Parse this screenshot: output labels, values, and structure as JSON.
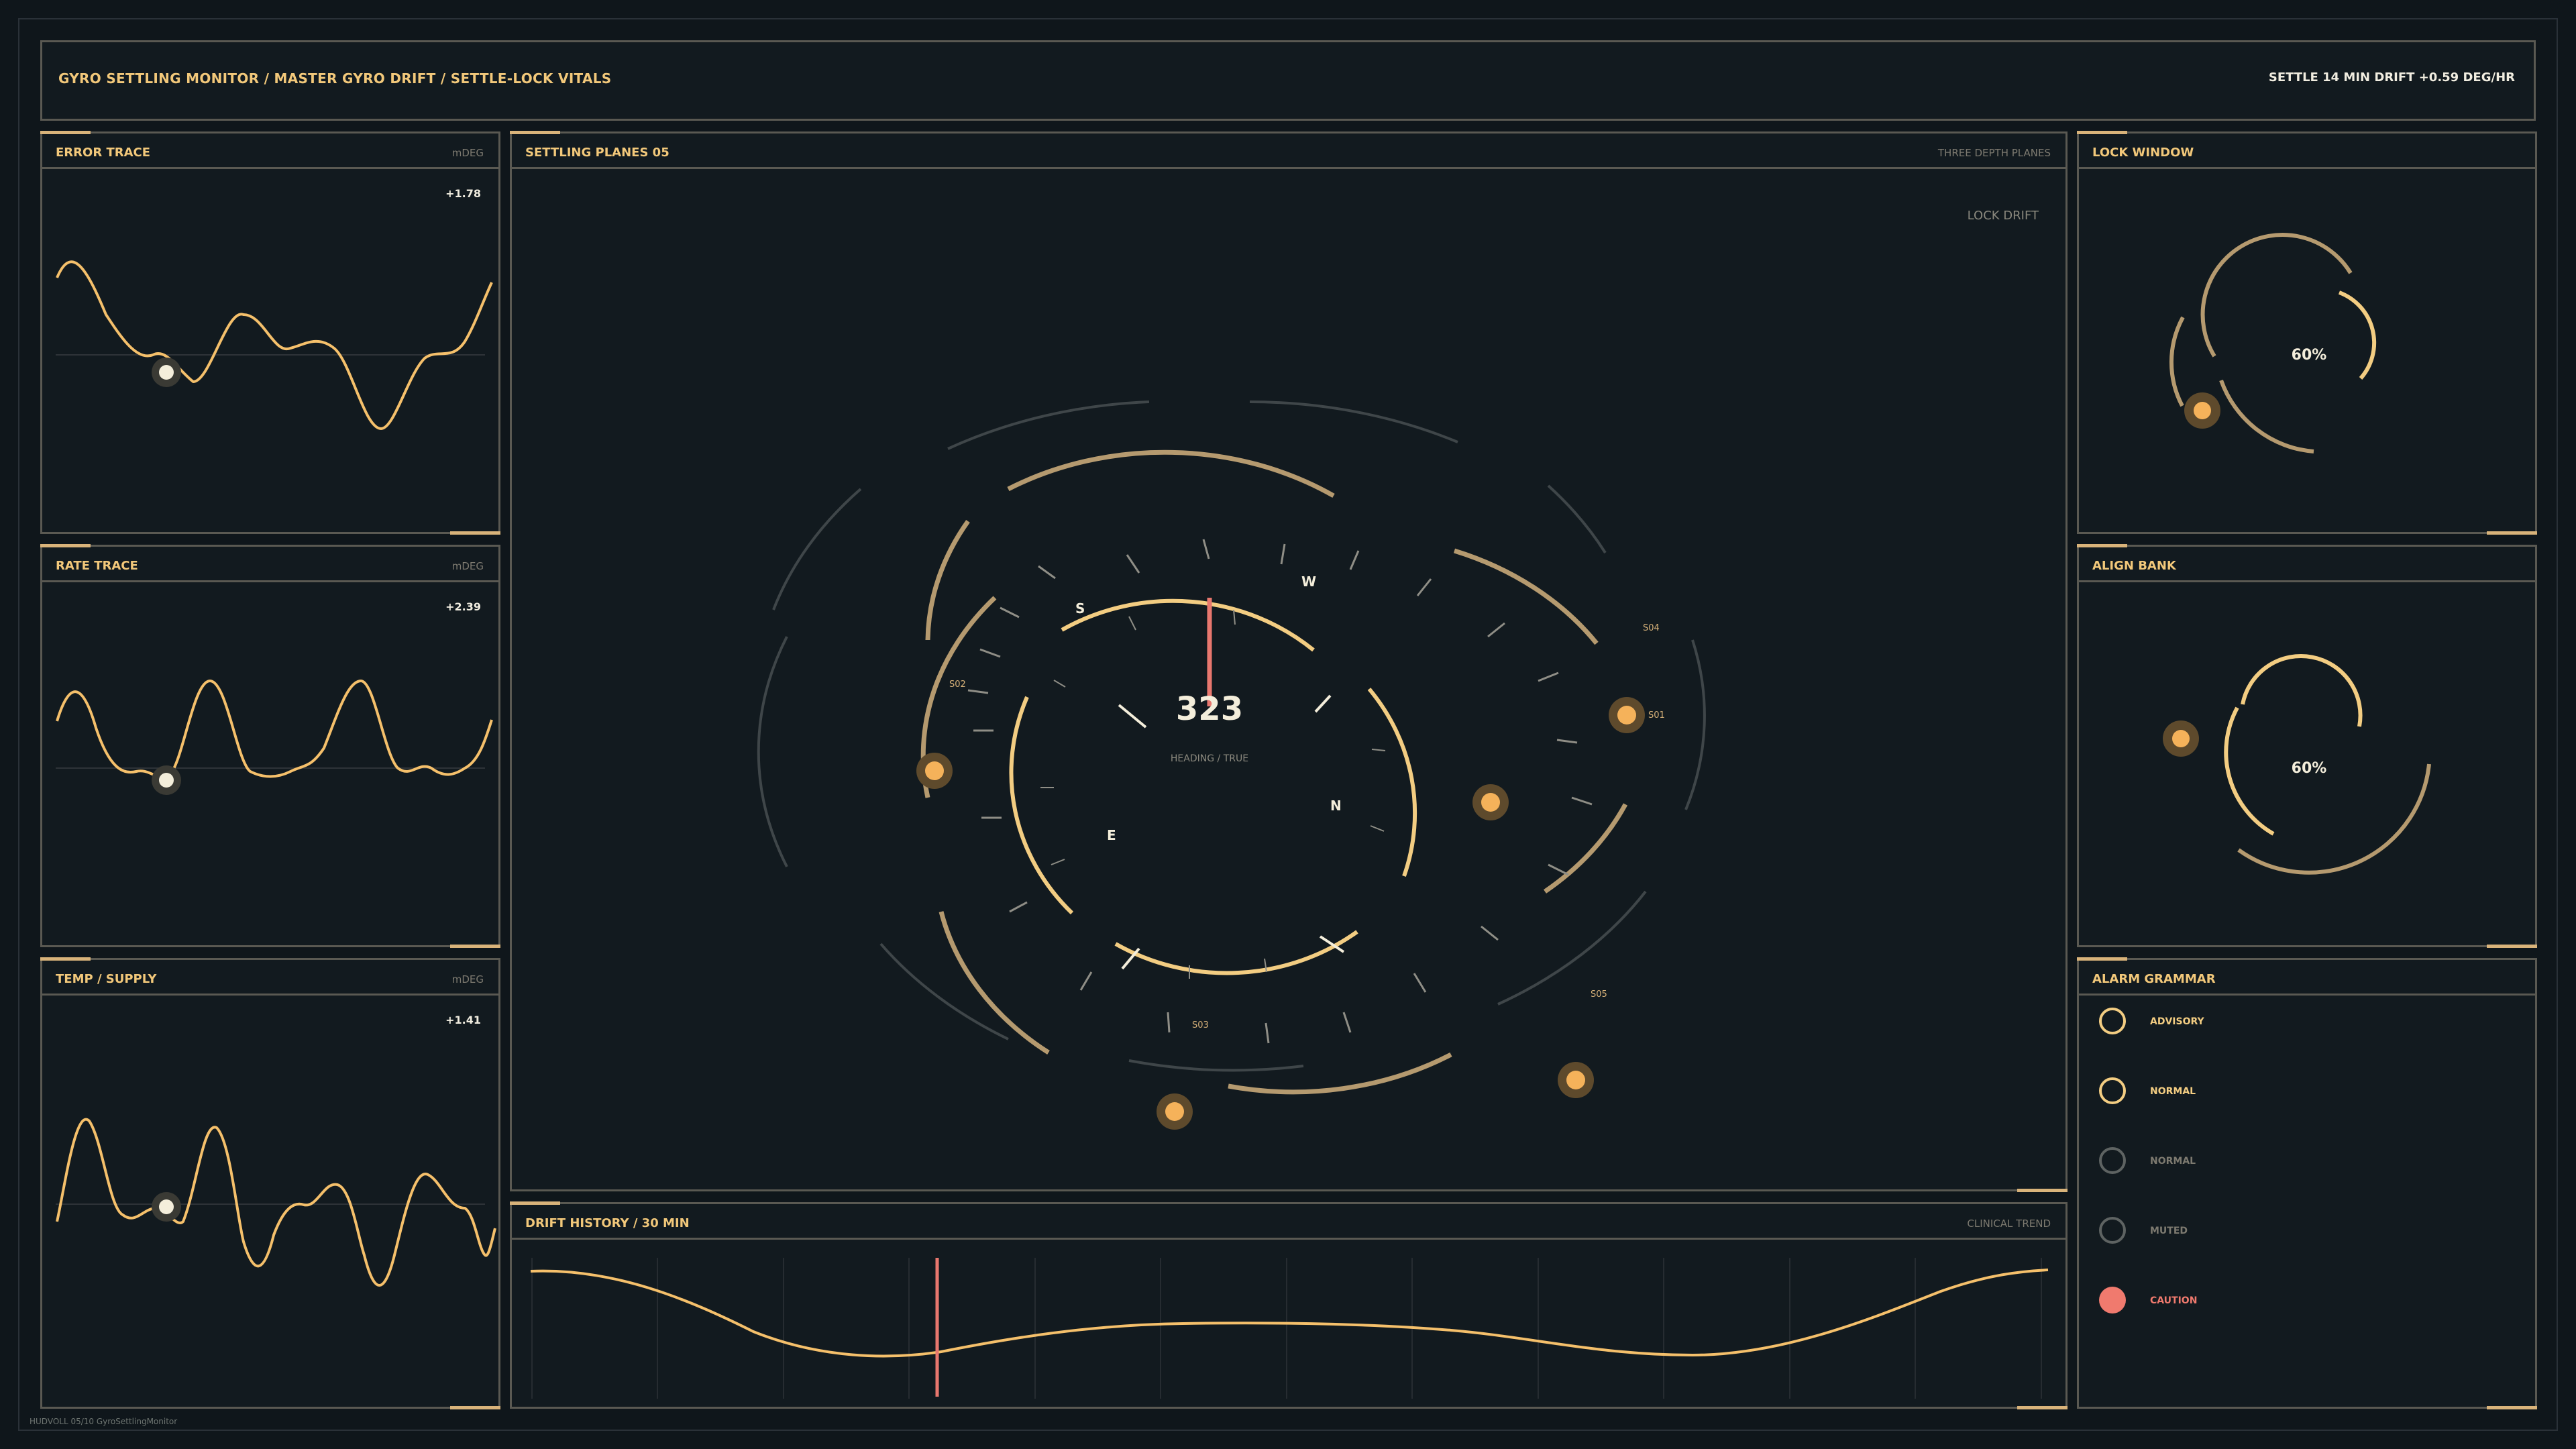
{
  "header": {
    "title": "GYRO SETTLING MONITOR / MASTER GYRO DRIFT / SETTLE-LOCK VITALS",
    "status": "SETTLE 14 MIN   DRIFT +0.59 DEG/HR"
  },
  "left_panels": [
    {
      "title": "ERROR TRACE",
      "unit": "mDEG",
      "readout": "+1.78"
    },
    {
      "title": "RATE TRACE",
      "unit": "mDEG",
      "readout": "+2.39"
    },
    {
      "title": "TEMP / SUPPLY",
      "unit": "mDEG",
      "readout": "+1.41"
    }
  ],
  "center": {
    "title": "SETTLING PLANES 05",
    "subtitle": "THREE DEPTH PLANES",
    "lock_drift": "LOCK DRIFT",
    "heading_value": "323",
    "heading_label": "HEADING / TRUE",
    "cardinals": {
      "s": "S",
      "w": "W",
      "e": "E",
      "n": "N"
    },
    "markers": [
      "S01",
      "S02",
      "S03",
      "S04",
      "S05"
    ]
  },
  "drift_history": {
    "title": "DRIFT HISTORY / 30 MIN",
    "subtitle": "CLINICAL TREND"
  },
  "right_panels": {
    "lock_window": {
      "title": "LOCK WINDOW",
      "value": "60%",
      "level": 0.6
    },
    "align_bank": {
      "title": "ALIGN BANK",
      "value": "60%",
      "level": 0.6
    },
    "alarm_grammar": {
      "title": "ALARM GRAMMAR",
      "items": [
        {
          "label": "ADVISORY",
          "state": "advisory"
        },
        {
          "label": "NORMAL",
          "state": "normal"
        },
        {
          "label": "NORMAL",
          "state": "normal-dim"
        },
        {
          "label": "MUTED",
          "state": "muted"
        },
        {
          "label": "CAUTION",
          "state": "caution"
        }
      ]
    }
  },
  "footer": "HUDVOLL 05/10 GyroSettlingMonitor",
  "colors": {
    "accent": "#f2c87a",
    "caution": "#f07a6e",
    "muted": "#6e7571",
    "trace": "#f5c06b",
    "border": "#5a5952",
    "background": "#121a1f"
  }
}
